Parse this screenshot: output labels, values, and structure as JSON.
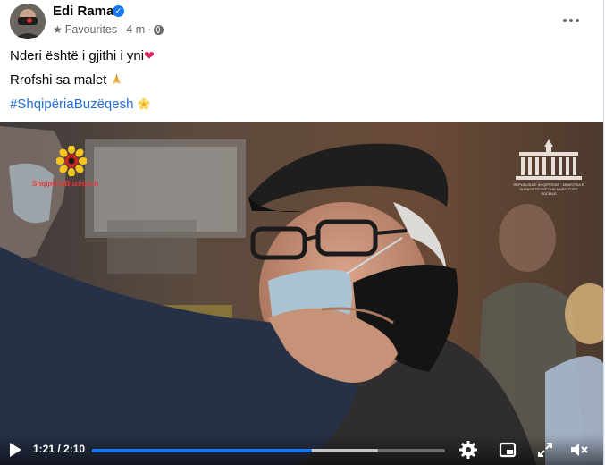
{
  "post": {
    "author": "Edi Rama",
    "verified_mark": "✓",
    "audience": "Favourites",
    "separator": "·",
    "time_ago": "4 m",
    "more_menu_icon": "more-dots-icon"
  },
  "message": {
    "line1_text": "Nderi është i gjithi i yni",
    "line1_emoji": "❤",
    "line2_text": "Rrofshi sa malet",
    "line2_emoji": "🙏",
    "hashtag": "#ShqipëriaBuzëqesh",
    "hashtag_emoji": "🌼"
  },
  "video": {
    "overlay_logo_text": "ShqipëriaBuzëqesh",
    "ministry_text": "REPUBLIKA E SHQIPËRISË · MINISTRIA E SHËNDETËSISË DHE MBROJTJES SOCIALE",
    "current_time": "1:21",
    "duration": "2:10",
    "time_display": "1:21 / 2:10",
    "progress_fraction": 0.623,
    "buffered_fraction": 0.81
  },
  "colors": {
    "link": "#216fdb",
    "progress_played": "#1877f2",
    "verified": "#1877f2"
  }
}
